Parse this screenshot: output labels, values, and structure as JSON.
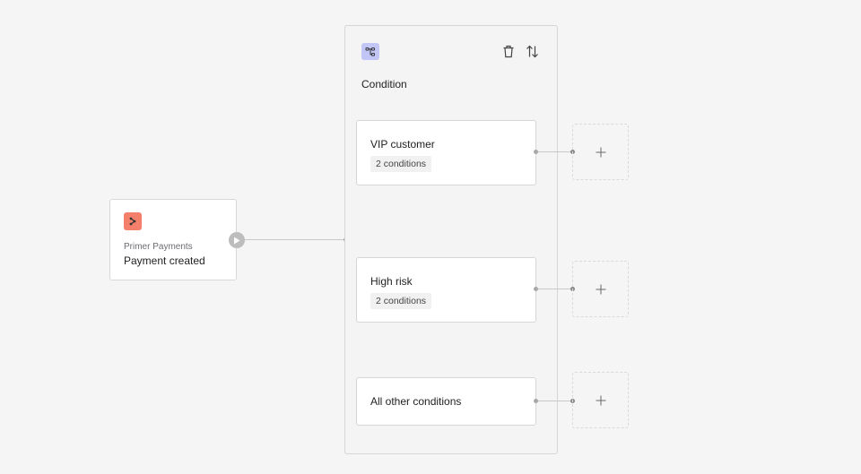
{
  "trigger": {
    "provider": "Primer Payments",
    "event": "Payment created",
    "icon": "primer-logo-icon",
    "icon_color": "#f4806c"
  },
  "condition_panel": {
    "title": "Condition",
    "icon": "branch-condition-icon",
    "icon_color": "#c1c6f7",
    "actions": [
      {
        "name": "delete",
        "icon": "trash-icon"
      },
      {
        "name": "reorder",
        "icon": "sort-arrows-icon"
      }
    ],
    "branches": [
      {
        "name": "VIP customer",
        "badge": "2 conditions"
      },
      {
        "name": "High risk",
        "badge": "2 conditions"
      },
      {
        "name": "All other conditions",
        "badge": null
      }
    ]
  },
  "add_step": {
    "icon": "plus-icon",
    "label": "+"
  }
}
